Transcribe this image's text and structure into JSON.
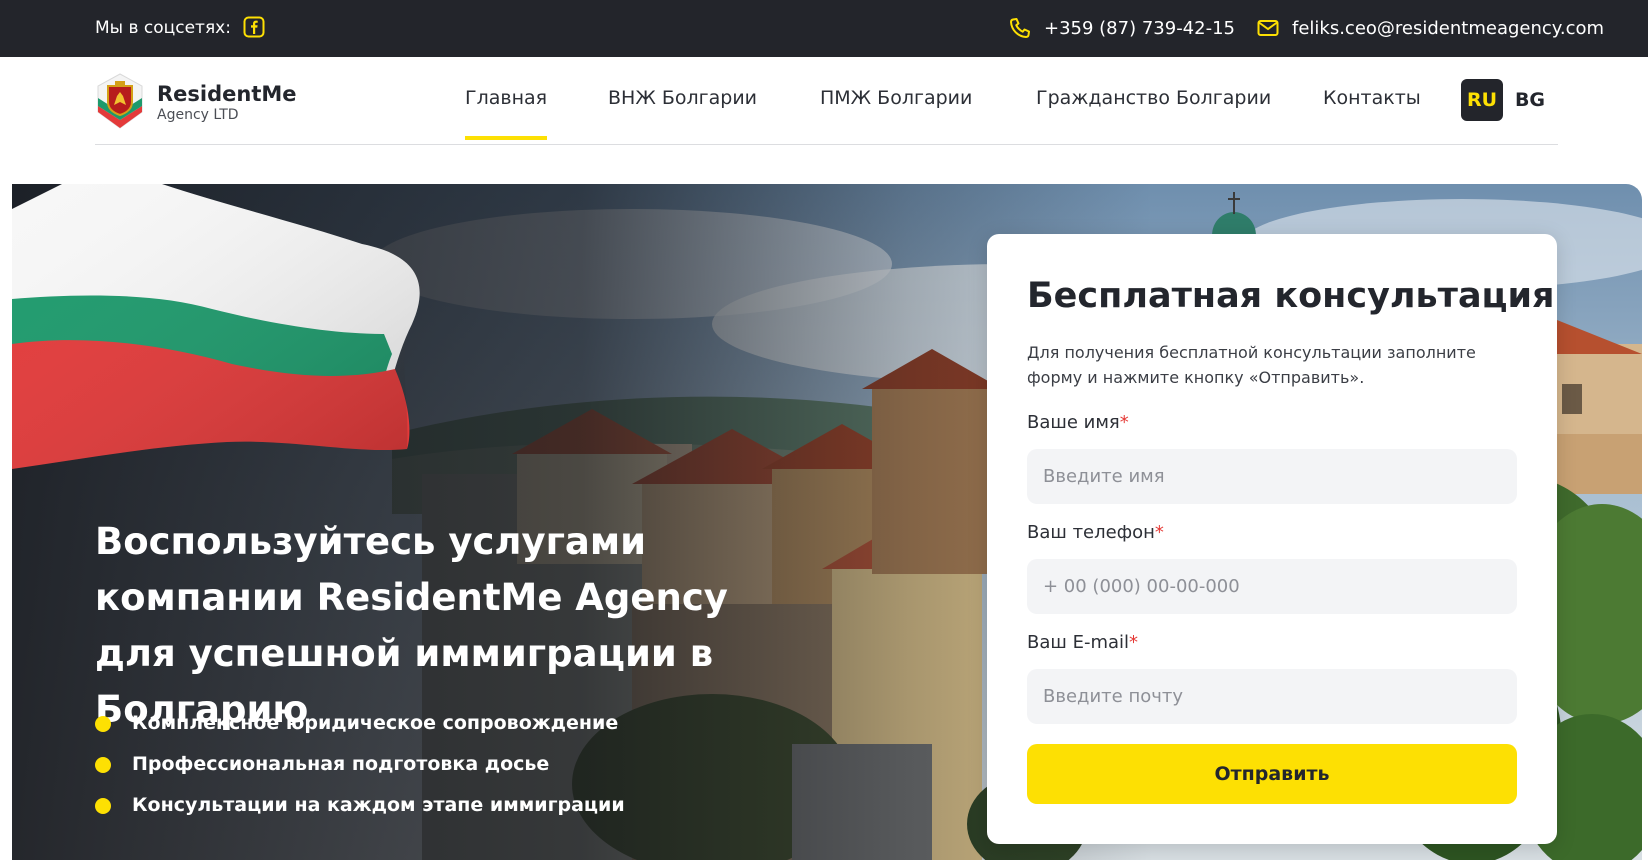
{
  "topbar": {
    "social_label": "Мы в соцсетях:",
    "phone": "+359 (87) 739-42-15",
    "email": "feliks.ceo@residentmeagency.com"
  },
  "logo": {
    "name": "ResidentMe",
    "subtitle": "Agency LTD"
  },
  "nav": {
    "items": [
      {
        "label": "Главная",
        "active": true
      },
      {
        "label": "ВНЖ Болгарии",
        "active": false
      },
      {
        "label": "ПМЖ Болгарии",
        "active": false
      },
      {
        "label": "Гражданство Болгарии",
        "active": false
      },
      {
        "label": "Контакты",
        "active": false
      }
    ],
    "languages": [
      {
        "label": "RU",
        "active": true
      },
      {
        "label": "BG",
        "active": false
      }
    ]
  },
  "hero": {
    "title": "Воспользуйтесь услугами компании ResidentMe Agency для успешной иммиграции в Болгарию",
    "bullets": [
      "Комплексное юридическое сопровождение",
      "Профессиональная подготовка досье",
      "Консультации на каждом этапе иммиграции"
    ]
  },
  "form": {
    "title": "Бесплатная консультация",
    "description": "Для получения бесплатной консультации заполните форму и нажмите кнопку «Отправить».",
    "required_mark": "*",
    "name_label": "Ваше имя",
    "name_placeholder": "Введите имя",
    "name_value": "",
    "phone_label": "Ваш телефон",
    "phone_placeholder": "+ 00 (000) 00-00-000",
    "phone_value": "",
    "email_label": "Ваш E-mail",
    "email_placeholder": "Введите почту",
    "email_value": "",
    "submit_label": "Отправить"
  },
  "colors": {
    "accent": "#fde003",
    "dark": "#23252b",
    "required": "#e53935",
    "flag_white": "#f7f7f7",
    "flag_green": "#1d9a6c",
    "flag_red": "#e43a3a"
  },
  "icons": [
    "facebook-icon",
    "phone-icon",
    "mail-icon",
    "bulgarian-coat-of-arms-logo"
  ]
}
